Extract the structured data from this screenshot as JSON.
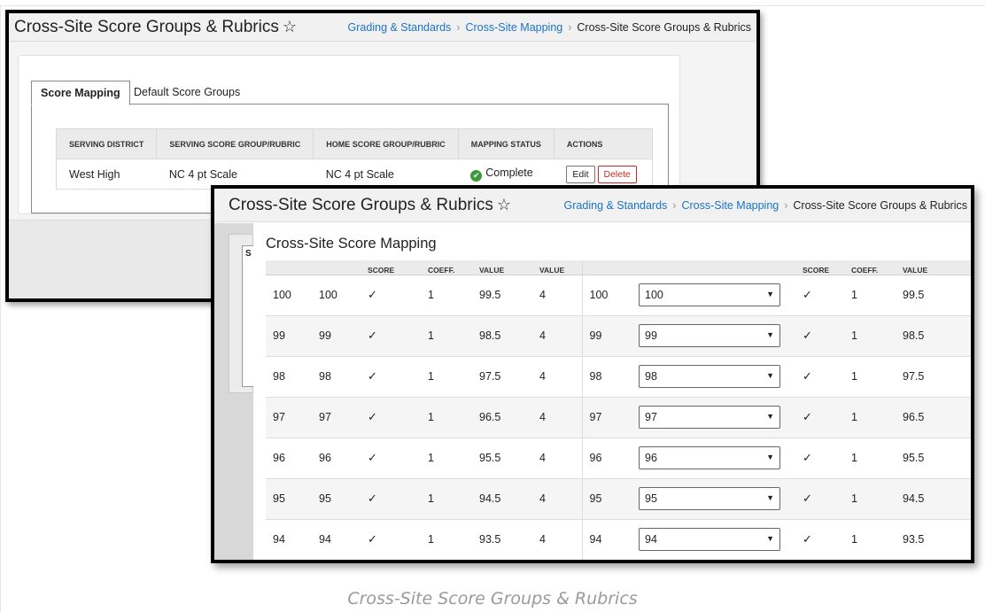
{
  "screen1": {
    "title": "Cross-Site Score Groups & Rubrics",
    "star": "☆",
    "breadcrumb": [
      "Grading & Standards",
      "Cross-Site Mapping",
      "Cross-Site Score Groups & Rubrics"
    ],
    "tabs": [
      {
        "label": "Score Mapping",
        "active": true
      },
      {
        "label": "Default Score Groups",
        "active": false
      }
    ],
    "table": {
      "headers": [
        "SERVING DISTRICT",
        "SERVING SCORE GROUP/RUBRIC",
        "HOME SCORE GROUP/RUBRIC",
        "MAPPING STATUS",
        "ACTIONS"
      ],
      "row": {
        "serving_district": "West High",
        "serving_group": "NC 4 pt Scale",
        "home_group": "NC 4 pt Scale",
        "status": "Complete",
        "edit_label": "Edit",
        "delete_label": "Delete"
      }
    }
  },
  "screen2": {
    "title": "Cross-Site Score Groups & Rubrics",
    "star": "☆",
    "breadcrumb": [
      "Grading & Standards",
      "Cross-Site Mapping",
      "Cross-Site Score Groups & Rubrics"
    ],
    "subtitle": "Cross-Site Score Mapping",
    "left_partial_char": "S",
    "headers": [
      "",
      "",
      "SCORE",
      "COEFF.",
      "VALUE",
      "VALUE",
      "",
      "",
      "SCORE",
      "COEFF.",
      "VALUE"
    ],
    "rows": [
      {
        "a": "100",
        "b": "100",
        "check": "✓",
        "coeff": "1",
        "value": "99.5",
        "value2": "4",
        "home": "100",
        "select": "100",
        "check2": "✓",
        "coeff2": "1",
        "value3": "99.5"
      },
      {
        "a": "99",
        "b": "99",
        "check": "✓",
        "coeff": "1",
        "value": "98.5",
        "value2": "4",
        "home": "99",
        "select": "99",
        "check2": "✓",
        "coeff2": "1",
        "value3": "98.5"
      },
      {
        "a": "98",
        "b": "98",
        "check": "✓",
        "coeff": "1",
        "value": "97.5",
        "value2": "4",
        "home": "98",
        "select": "98",
        "check2": "✓",
        "coeff2": "1",
        "value3": "97.5"
      },
      {
        "a": "97",
        "b": "97",
        "check": "✓",
        "coeff": "1",
        "value": "96.5",
        "value2": "4",
        "home": "97",
        "select": "97",
        "check2": "✓",
        "coeff2": "1",
        "value3": "96.5"
      },
      {
        "a": "96",
        "b": "96",
        "check": "✓",
        "coeff": "1",
        "value": "95.5",
        "value2": "4",
        "home": "96",
        "select": "96",
        "check2": "✓",
        "coeff2": "1",
        "value3": "95.5"
      },
      {
        "a": "95",
        "b": "95",
        "check": "✓",
        "coeff": "1",
        "value": "94.5",
        "value2": "4",
        "home": "95",
        "select": "95",
        "check2": "✓",
        "coeff2": "1",
        "value3": "94.5"
      },
      {
        "a": "94",
        "b": "94",
        "check": "✓",
        "coeff": "1",
        "value": "93.5",
        "value2": "4",
        "home": "94",
        "select": "94",
        "check2": "✓",
        "coeff2": "1",
        "value3": "93.5"
      }
    ]
  },
  "caption": "Cross-Site Score Groups & Rubrics",
  "colors": {
    "link": "#1a73c9",
    "delete": "#c62828",
    "complete": "#3c9a3c"
  },
  "icons": {
    "favorite": "star-outline-icon",
    "status": "check-circle-icon",
    "dropdown": "caret-down-icon"
  }
}
